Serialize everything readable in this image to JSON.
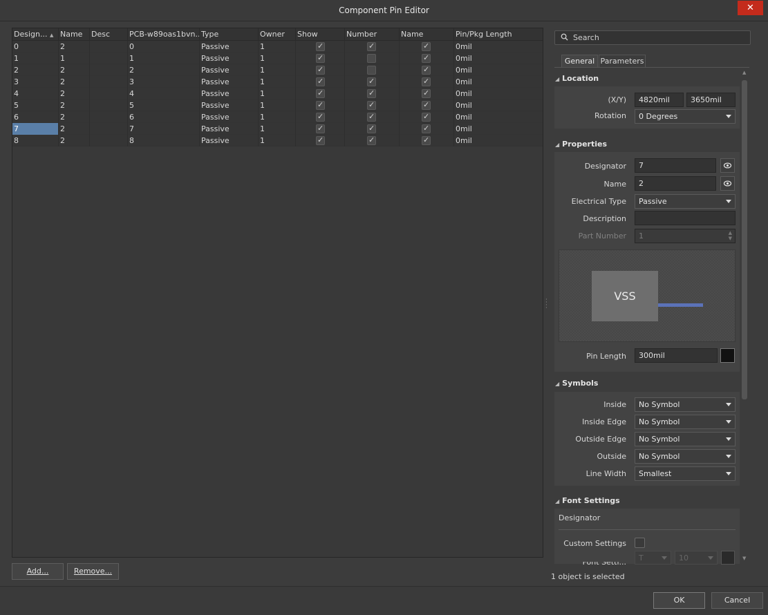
{
  "window": {
    "title": "Component Pin Editor",
    "close_glyph": "✕"
  },
  "grid": {
    "columns": [
      "Design...",
      "Name",
      "Desc",
      "PCB-w89oas1bvn...",
      "Type",
      "Owner",
      "Show",
      "Number",
      "Name",
      "Pin/Pkg Length"
    ],
    "sort_glyph": "▲",
    "rows": [
      {
        "designator": "0",
        "name": "2",
        "desc": "",
        "pcb": "0",
        "type": "Passive",
        "owner": "1",
        "show": true,
        "number": true,
        "name_vis": true,
        "length": "0mil"
      },
      {
        "designator": "1",
        "name": "1",
        "desc": "",
        "pcb": "1",
        "type": "Passive",
        "owner": "1",
        "show": true,
        "number": false,
        "name_vis": true,
        "length": "0mil"
      },
      {
        "designator": "2",
        "name": "2",
        "desc": "",
        "pcb": "2",
        "type": "Passive",
        "owner": "1",
        "show": true,
        "number": false,
        "name_vis": true,
        "length": "0mil"
      },
      {
        "designator": "3",
        "name": "2",
        "desc": "",
        "pcb": "3",
        "type": "Passive",
        "owner": "1",
        "show": true,
        "number": true,
        "name_vis": true,
        "length": "0mil"
      },
      {
        "designator": "4",
        "name": "2",
        "desc": "",
        "pcb": "4",
        "type": "Passive",
        "owner": "1",
        "show": true,
        "number": true,
        "name_vis": true,
        "length": "0mil"
      },
      {
        "designator": "5",
        "name": "2",
        "desc": "",
        "pcb": "5",
        "type": "Passive",
        "owner": "1",
        "show": true,
        "number": true,
        "name_vis": true,
        "length": "0mil"
      },
      {
        "designator": "6",
        "name": "2",
        "desc": "",
        "pcb": "6",
        "type": "Passive",
        "owner": "1",
        "show": true,
        "number": true,
        "name_vis": true,
        "length": "0mil"
      },
      {
        "designator": "7",
        "name": "2",
        "desc": "",
        "pcb": "7",
        "type": "Passive",
        "owner": "1",
        "show": true,
        "number": true,
        "name_vis": true,
        "length": "0mil",
        "selected": true
      },
      {
        "designator": "8",
        "name": "2",
        "desc": "",
        "pcb": "8",
        "type": "Passive",
        "owner": "1",
        "show": true,
        "number": true,
        "name_vis": true,
        "length": "0mil"
      }
    ]
  },
  "buttons": {
    "add": "Add...",
    "remove": "Remove...",
    "ok": "OK",
    "cancel": "Cancel"
  },
  "search": {
    "placeholder": "Search"
  },
  "tabs": [
    "General",
    "Parameters"
  ],
  "location": {
    "title": "Location",
    "xy_label": "(X/Y)",
    "x": "4820mil",
    "y": "3650mil",
    "rotation_label": "Rotation",
    "rotation": "0 Degrees"
  },
  "properties": {
    "title": "Properties",
    "designator_label": "Designator",
    "designator": "7",
    "name_label": "Name",
    "name": "2",
    "electrical_type_label": "Electrical Type",
    "electrical_type": "Passive",
    "description_label": "Description",
    "description": "",
    "part_number_label": "Part Number",
    "part_number": "1",
    "preview_text": "VSS",
    "pin_length_label": "Pin Length",
    "pin_length": "300mil",
    "pin_color": "#111111"
  },
  "symbols": {
    "title": "Symbols",
    "inside_label": "Inside",
    "inside": "No Symbol",
    "inside_edge_label": "Inside Edge",
    "inside_edge": "No Symbol",
    "outside_edge_label": "Outside Edge",
    "outside_edge": "No Symbol",
    "outside_label": "Outside",
    "outside": "No Symbol",
    "line_width_label": "Line Width",
    "line_width": "Smallest"
  },
  "font_settings": {
    "title": "Font Settings",
    "subheading": "Designator",
    "custom_settings_label": "Custom Settings",
    "font_label_partial": "Font Setti...",
    "font_size": "10",
    "font_glyph": "T"
  },
  "status": "1 object is selected",
  "colors": {
    "accent_selection": "#5a7fa8",
    "close_button": "#c42b1c",
    "pin_line": "#5b72b8"
  }
}
